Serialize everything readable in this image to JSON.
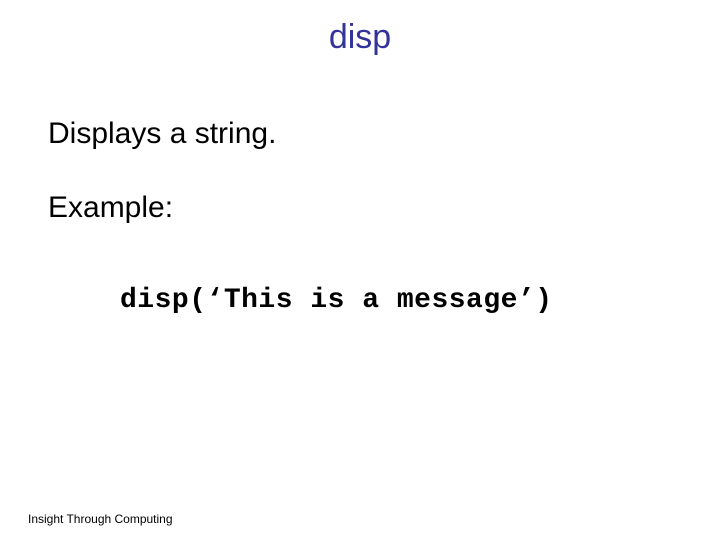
{
  "title": "disp",
  "body": {
    "line1": "Displays a string.",
    "line2": "Example:",
    "code": "disp(‘This is a message’)"
  },
  "footer": "Insight Through Computing"
}
